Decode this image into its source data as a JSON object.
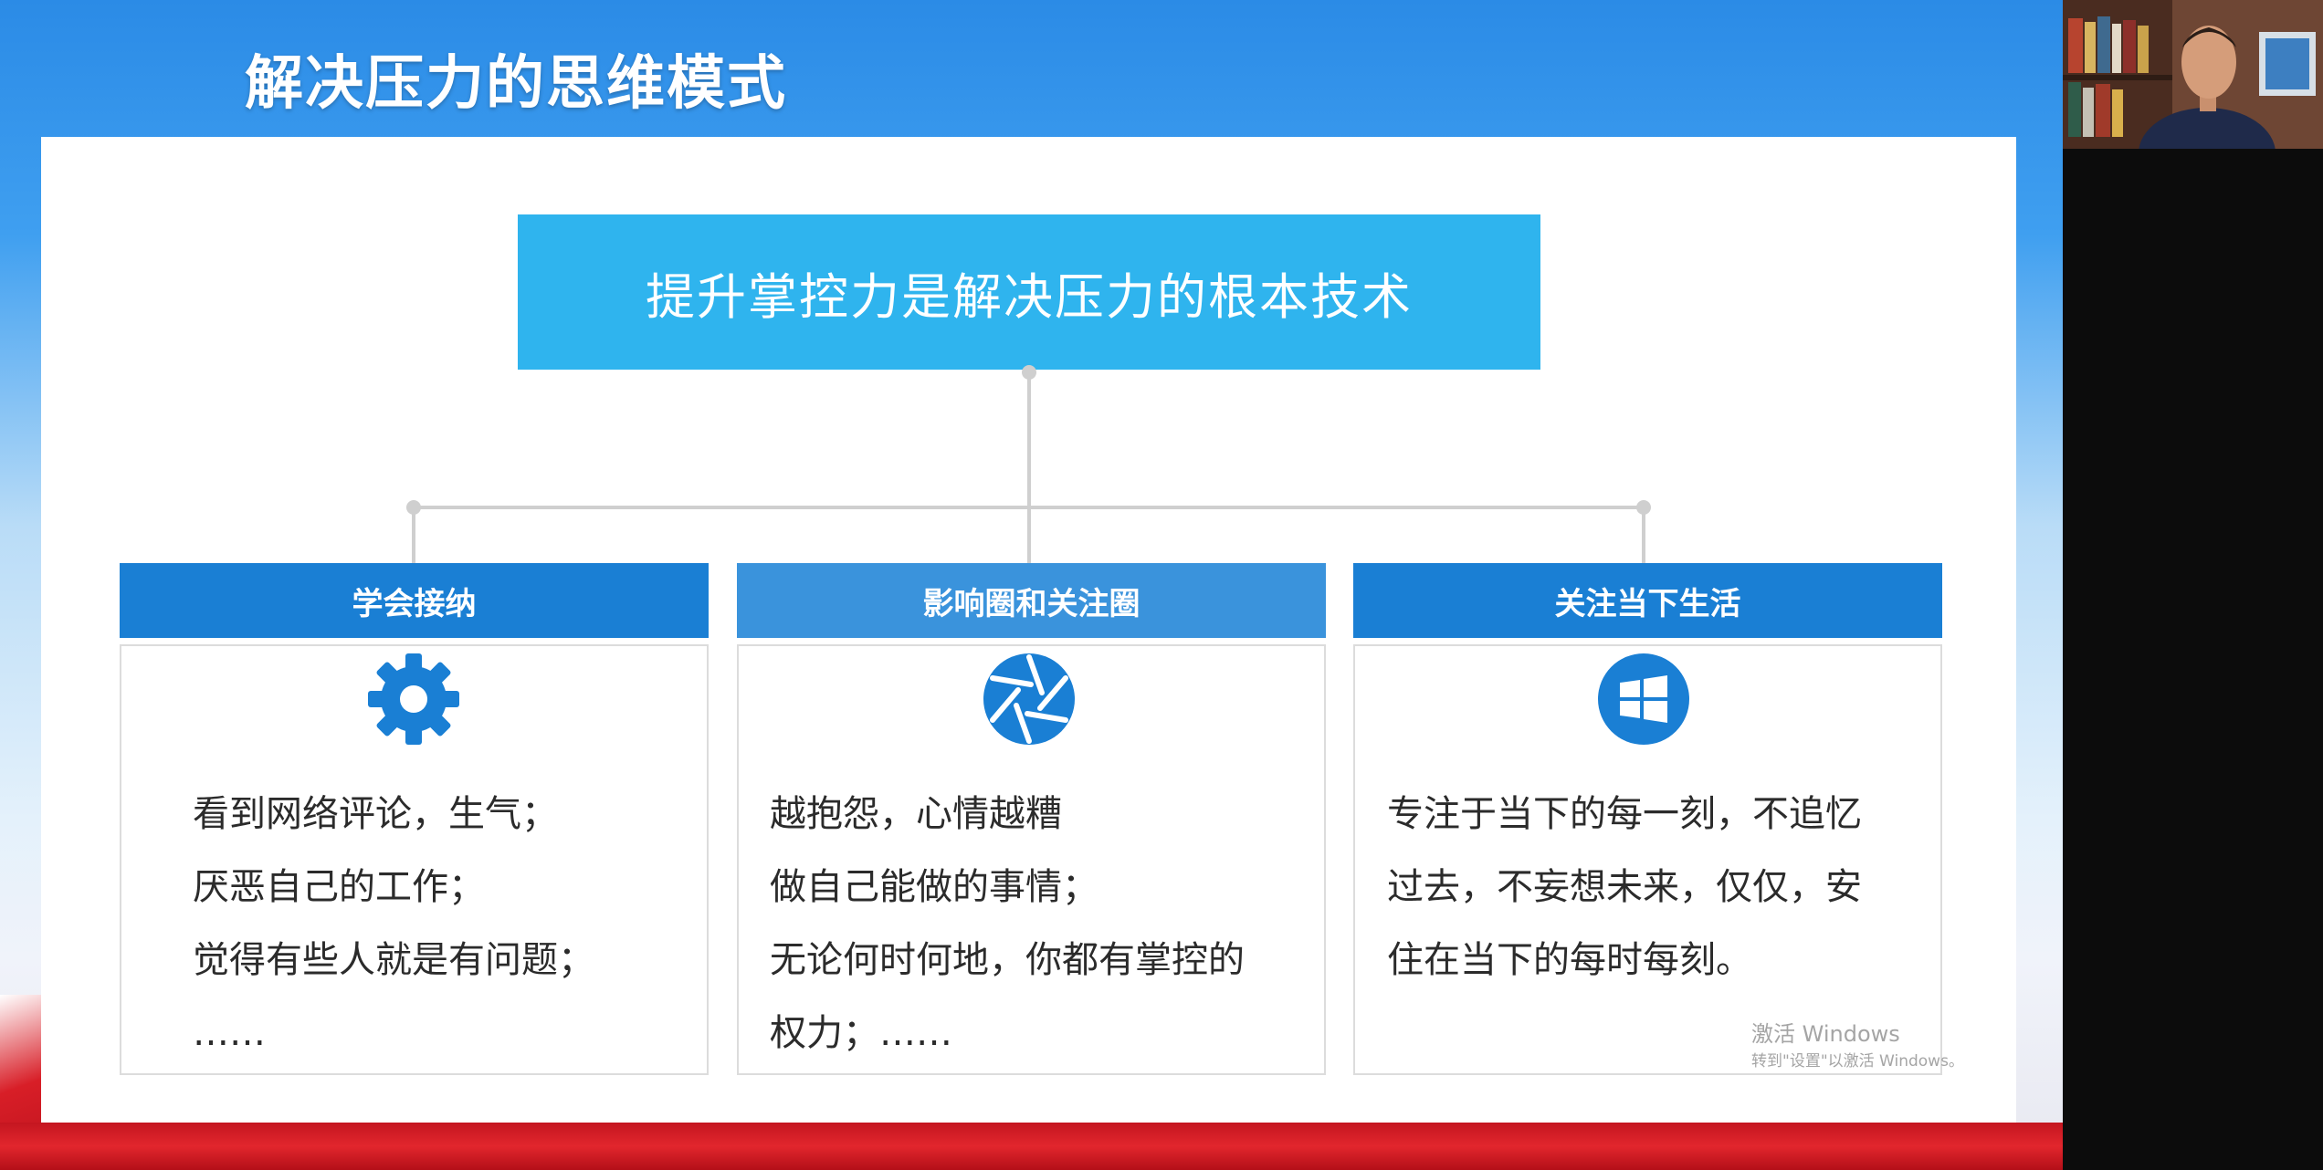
{
  "slide": {
    "title": "解决压力的思维模式",
    "root": "提升掌控力是解决压力的根本技术",
    "columns": [
      {
        "header": "学会接纳",
        "header_color": "#1a7fd4",
        "icon": "gear-icon",
        "lines": [
          "看到网络评论，生气；",
          "厌恶自己的工作；",
          "觉得有些人就是有问题；",
          "……"
        ]
      },
      {
        "header": "影响圈和关注圈",
        "header_color": "#3a93dc",
        "icon": "aperture-icon",
        "lines": [
          "越抱怨，心情越糟",
          "做自己能做的事情；",
          "无论何时何地，你都有掌控的",
          "权力；……"
        ]
      },
      {
        "header": "关注当下生活",
        "header_color": "#1a7fd4",
        "icon": "windows-icon",
        "lines": [
          "专注于当下的每一刻，不追忆",
          "过去，不妄想未来，仅仅，安",
          "住在当下的每时每刻。"
        ]
      }
    ]
  },
  "watermark": {
    "line1": "激活 Windows",
    "line2": "转到\"设置\"以激活 Windows。"
  },
  "colors": {
    "accent_top_box": "#2fb4ee",
    "header_blue": "#1a7fd4",
    "connector_gray": "#cfcfcf",
    "bottom_red": "#d81e27"
  }
}
